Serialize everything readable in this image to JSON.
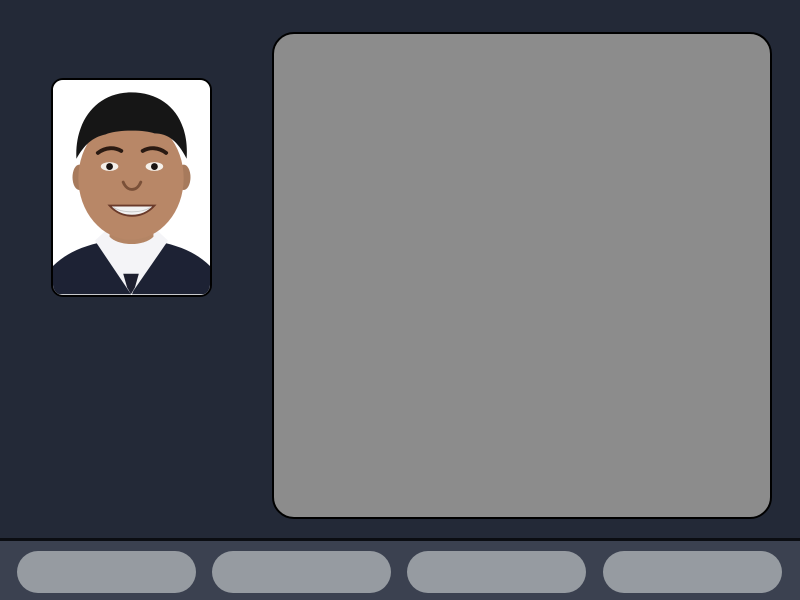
{
  "colors": {
    "background": "#232937",
    "panel": "#8c8c8c",
    "bottom_bar": "#3b4150",
    "button": "#969ba1",
    "border": "#000000"
  },
  "portrait": {
    "icon": "person-photo"
  },
  "main_panel": {
    "content": ""
  },
  "bottom_bar": {
    "buttons": [
      {
        "label": ""
      },
      {
        "label": ""
      },
      {
        "label": ""
      },
      {
        "label": ""
      }
    ]
  }
}
